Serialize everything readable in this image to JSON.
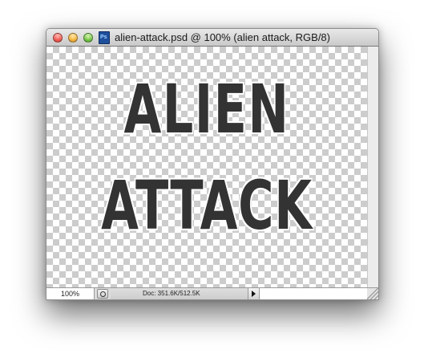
{
  "window": {
    "title": "alien-attack.psd @ 100% (alien attack, RGB/8)",
    "file_icon": "photoshop-document-icon"
  },
  "canvas": {
    "artwork_lines": [
      "ALIEN",
      "ATTACK"
    ],
    "text_color": "#333333",
    "outline_color": "#ffffff",
    "transparency_pattern": "checkerboard"
  },
  "status_bar": {
    "zoom_level": "100%",
    "doc_info": "Doc: 351.6K/512.5K"
  },
  "colors": {
    "close": "#f0584f",
    "minimize": "#f4b33a",
    "zoom": "#73c545"
  }
}
